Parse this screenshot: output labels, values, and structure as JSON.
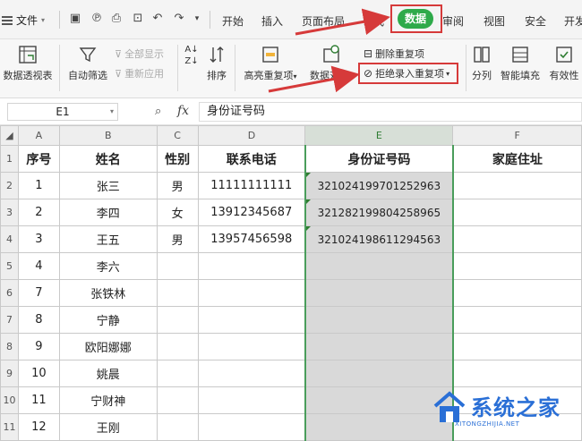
{
  "menubar": {
    "file_label": "文件",
    "tabs": [
      "开始",
      "插入",
      "页面布局",
      "公式",
      "数据",
      "审阅",
      "视图",
      "安全",
      "开发"
    ],
    "active_tab": "数据"
  },
  "ribbon": {
    "pivot": "数据透视表",
    "autofilter": "自动筛选",
    "show_all": "全部显示",
    "reapply": "重新应用",
    "sort": "排序",
    "highlight_dup": "高亮重复项",
    "compare": "数据对比",
    "delete_dup": "删除重复项",
    "reject_dup": "拒绝录入重复项",
    "split": "分列",
    "smart_fill": "智能填充",
    "validity": "有效性"
  },
  "formula_bar": {
    "cell_ref": "E1",
    "fx": "fx",
    "content": "身份证号码"
  },
  "grid": {
    "columns": [
      "A",
      "B",
      "C",
      "D",
      "E",
      "F"
    ],
    "selected_column": "E",
    "row_numbers": [
      "1",
      "2",
      "3",
      "4",
      "5",
      "6",
      "7",
      "8",
      "9",
      "10",
      "11"
    ],
    "header": [
      "序号",
      "姓名",
      "性别",
      "联系电话",
      "身份证号码",
      "家庭住址"
    ],
    "rows": [
      [
        "1",
        "张三",
        "男",
        "11111111111",
        "321024199701252963",
        ""
      ],
      [
        "2",
        "李四",
        "女",
        "13912345687",
        "321282199804258965",
        ""
      ],
      [
        "3",
        "王五",
        "男",
        "13957456598",
        "321024198611294563",
        ""
      ],
      [
        "4",
        "李六",
        "",
        "",
        "",
        ""
      ],
      [
        "7",
        "张铁林",
        "",
        "",
        "",
        ""
      ],
      [
        "8",
        "宁静",
        "",
        "",
        "",
        ""
      ],
      [
        "9",
        "欧阳娜娜",
        "",
        "",
        "",
        ""
      ],
      [
        "10",
        "姚晨",
        "",
        "",
        "",
        ""
      ],
      [
        "11",
        "宁财神",
        "",
        "",
        "",
        ""
      ],
      [
        "12",
        "王刚",
        "",
        "",
        "",
        ""
      ]
    ]
  },
  "watermark": {
    "text": "系统之家",
    "sub": "XITONGZHIJIA.NET"
  },
  "colors": {
    "active_tab_bg": "#2eaa4a",
    "highlight_red": "#d63a3a",
    "selection_green": "#4a9d5b",
    "column_fill": "#d9d9d9"
  }
}
